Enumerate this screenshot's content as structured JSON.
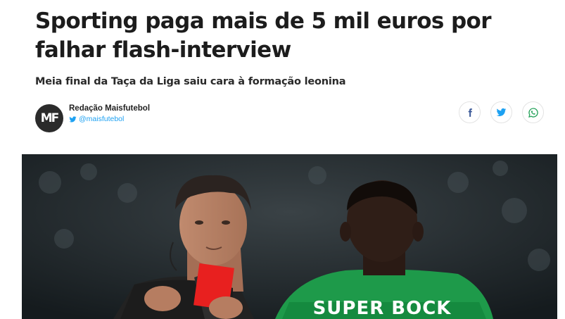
{
  "article": {
    "title": "Sporting paga mais de 5 mil euros por falhar flash-interview",
    "subtitle": "Meia final da Taça da Liga saiu cara à formação leonina"
  },
  "author": {
    "name": "Redação Maisfutebol",
    "handle": "@maisfutebol",
    "avatar_initials": "MF"
  },
  "share": {
    "icons": [
      "facebook-icon",
      "twitter-icon",
      "whatsapp-icon"
    ],
    "colors": {
      "facebook": "#3b5998",
      "twitter": "#1da1f2",
      "whatsapp": "#25d366"
    }
  },
  "hero_image": {
    "jersey_text": "SUPER BOCK",
    "colors": {
      "jersey_green": "#1e9a4a",
      "card_red": "#e8201f"
    }
  }
}
